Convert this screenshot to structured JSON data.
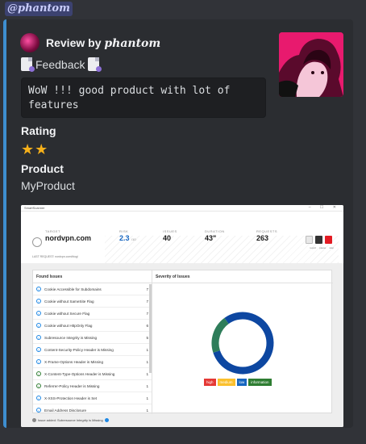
{
  "mention": {
    "text": "@phantom"
  },
  "embed": {
    "accent_color": "#3e8ed0",
    "author": {
      "prefix": "Review by ",
      "brand": "phantom"
    },
    "feedback": {
      "label": "Feedback",
      "icon": "document-pen-icon"
    },
    "comment": "WoW !!! good product with lot of features",
    "rating": {
      "title": "Rating",
      "stars": "★★",
      "value": 2
    },
    "product": {
      "title": "Product",
      "name": "MyProduct"
    }
  },
  "screenshot": {
    "app_title": "SmartScanner",
    "window_controls": "– ☐ ✕",
    "header": {
      "target_label": "TARGET",
      "target_value": "nordvpn.com",
      "risk_label": "RISK",
      "risk_value": "2.3",
      "risk_suffix": "/10",
      "issues_label": "ISSUES",
      "issues_value": "40",
      "duration_label": "DURATION",
      "duration_value": "43\"",
      "requests_label": "REQUESTS",
      "requests_value": "263",
      "last_request": "LAST REQUEST: nordvpn.com/blog/",
      "actions": [
        "report",
        "pause",
        "stop"
      ]
    },
    "found_issues": {
      "title": "Found Issues",
      "items": [
        {
          "name": "Cookie Accessible for Subdomains",
          "count": "7",
          "icon": "info-icon"
        },
        {
          "name": "Cookie without SameSite Flag",
          "count": "7",
          "icon": "info-icon"
        },
        {
          "name": "Cookie without Secure Flag",
          "count": "7",
          "icon": "info-icon"
        },
        {
          "name": "Cookie without HttpOnly Flag",
          "count": "6",
          "icon": "info-icon"
        },
        {
          "name": "Subresource Integrity is Missing",
          "count": "5",
          "icon": "info-icon"
        },
        {
          "name": "Content-Security-Policy Header is Missing",
          "count": "1",
          "icon": "info-icon"
        },
        {
          "name": "X-Frame-Options Header is Missing",
          "count": "1",
          "icon": "info-icon"
        },
        {
          "name": "X-Content-Type-Options Header is Missing",
          "count": "1",
          "icon": "info-icon-green"
        },
        {
          "name": "Referrer-Policy Header is Missing",
          "count": "1",
          "icon": "info-icon-green"
        },
        {
          "name": "X-XSS-Protection Header is Set",
          "count": "1",
          "icon": "info-icon"
        },
        {
          "name": "Email Address Disclosure",
          "count": "1",
          "icon": "info-icon"
        }
      ]
    },
    "severity": {
      "title": "Severity of Issues",
      "legend": [
        {
          "label": "high",
          "color": "#e53935"
        },
        {
          "label": "medium",
          "color": "#fbc02d"
        },
        {
          "label": "low",
          "color": "#1565c0"
        },
        {
          "label": "information",
          "color": "#2e7d32"
        }
      ]
    },
    "footer": "Issue added: Subresource Integrity is Missing"
  },
  "chart_data": {
    "type": "pie",
    "title": "Severity of Issues",
    "categories": [
      "high",
      "medium",
      "low",
      "information"
    ],
    "values": [
      0,
      0,
      32,
      8
    ],
    "colors": [
      "#e53935",
      "#fbc02d",
      "#0d47a1",
      "#2e7d5a"
    ]
  }
}
